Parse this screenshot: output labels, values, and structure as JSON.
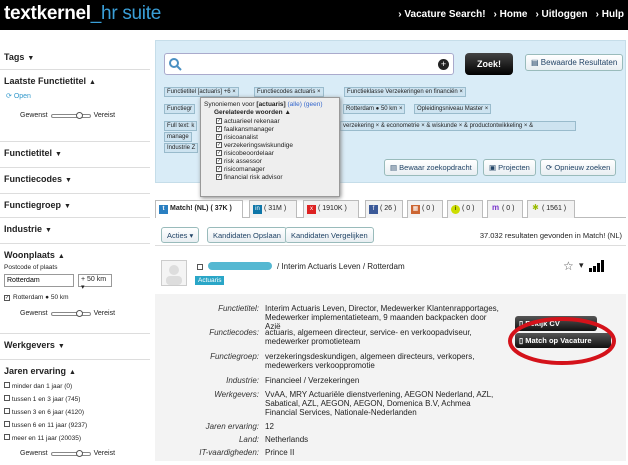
{
  "header": {
    "logo_part1": "textkernel",
    "logo_part2": "_hr suite",
    "nav": [
      "› Vacature Search!",
      "› Home",
      "› Uitloggen",
      "› Hulp"
    ]
  },
  "sidebar": {
    "tags": "Tags",
    "laatste": "Laatste Functietitel",
    "open": "Open",
    "gewenst": "Gewenst",
    "vereist": "Vereist",
    "functietitel": "Functietitel",
    "functiecodes": "Functiecodes",
    "functiegroep": "Functiegroep",
    "industrie": "Industrie",
    "woonplaats": "Woonplaats",
    "postcode_label": "Postcode of plaats",
    "plaats_value": "Rotterdam",
    "radius_value": "+ 50 km",
    "rotterdam_check": "Rotterdam ● 50 km",
    "werkgevers": "Werkgevers",
    "jaren": "Jaren ervaring",
    "jaren_options": [
      "minder dan 1 jaar (0)",
      "tussen 1 en 3 jaar (745)",
      "tussen 3 en 6 jaar (4120)",
      "tussen 6 en 11 jaar (9237)",
      "meer en 11 jaar (20035)"
    ]
  },
  "search": {
    "button": "Zoek!",
    "saved": "Bewaarde Resultaten",
    "save_query": "Bewaar zoekopdracht",
    "projects": "Projecten",
    "reopen": "Opnieuw zoeken"
  },
  "tags": {
    "t1": "Functietitel [actuaris] +6 ×",
    "t2": "Functiecodes  actuaris ×",
    "t3": "Functieklasse  Verzekeringen en financiën ×",
    "t4": "Functiegr",
    "t5": "Rotterdam ● 50 km ×",
    "t6": "Opleidingsniveau  Master ×",
    "t7": "Full text: k",
    "t8": "verzekering ×  &  econometrie ×  &  wiskunde ×  &  productontwikkeling ×  &",
    "t9": "manage",
    "t10": "Industrie  Z"
  },
  "popup": {
    "heading": "Synoniemen voor",
    "term": "[actuaris]",
    "links": "(alle) (geen)",
    "sub": "Gerelateerde woorden",
    "items": [
      "actuarieel rekenaar",
      "faalkansmanager",
      "risicoanalist",
      "verzekeringswiskundige",
      "risicobeoordelaar",
      "risk assessor",
      "risicomanager",
      "financial risk advisor"
    ]
  },
  "tabs": [
    "Match! (NL) ( 37K )",
    "( 31M )",
    "( 1910K )",
    "( 26 )",
    "( 0 )",
    "( 0 )",
    "( 0 )",
    "( 1561 )"
  ],
  "results": {
    "acties": "Acties ▾",
    "opslaan": "Kandidaten Opslaan",
    "vergelijken": "Kandidaten Vergelijken",
    "count": "37.032 resultaten gevonden in Match! (NL)"
  },
  "candidate": {
    "title": "/ Interim Actuaris Leven / Rotterdam",
    "badge": "Actuaris",
    "fields": [
      {
        "label": "Functietitel:",
        "value": "Interim Actuaris Leven, Director, Medewerker Klantenrapportages, Medewerker implementatieteam, 9 maanden backpacken door Azië"
      },
      {
        "label": "Functiecodes:",
        "value": "actuaris, algemeen directeur, service- en verkoopadviseur, medewerker promotieteam"
      },
      {
        "label": "Functiegroep:",
        "value": "verzekeringsdeskundigen, algemeen directeurs, verkopers, medewerkers verkooppromotie"
      },
      {
        "label": "Industrie:",
        "value": "Financieel / Verzekeringen"
      },
      {
        "label": "Werkgevers:",
        "value": "VvAA, MRY Actuariële dienstverlening, AEGON Nederland, AZL, Sabatical, AZL, AEGON, AEGON, Domenica B.V, Achmea Financial Services, Nationale-Nederlanden"
      },
      {
        "label": "Jaren ervaring:",
        "value": "12"
      },
      {
        "label": "Land:",
        "value": "Netherlands"
      },
      {
        "label": "IT-vaardigheden:",
        "value": "Prince II"
      }
    ],
    "bekijk": "Bekijk CV",
    "match": "Match op Vacature"
  }
}
